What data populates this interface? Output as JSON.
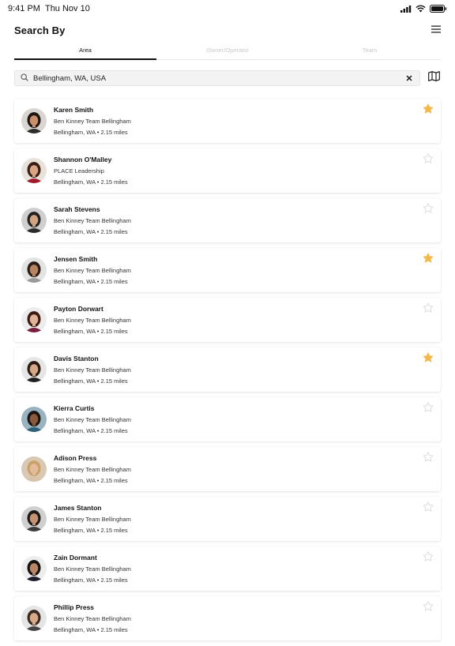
{
  "status": {
    "time": "9:41 PM",
    "date": "Thu Nov 10"
  },
  "header": {
    "title": "Search By"
  },
  "tabs": [
    {
      "label": "Area"
    },
    {
      "label": "Owner/Operator"
    },
    {
      "label": "Team"
    }
  ],
  "search": {
    "value": "Bellingham, WA, USA",
    "placeholder": ""
  },
  "colors": {
    "star_filled": "#f2b84b",
    "star_empty": "#d9d9d9",
    "accent": "#111111"
  },
  "agents": [
    {
      "name": "Karen Smith",
      "team": "Ben Kinney Team Bellingham",
      "location": "Bellingham, WA • 2.15 miles",
      "favorite": true,
      "avatar_bg": "#d9d5d0",
      "hair": "#1e1612",
      "skin": "#c98f6a",
      "shirt": "#2b2b2b"
    },
    {
      "name": "Shannon O'Malley",
      "team": "PLACE Leadership",
      "location": "Bellingham, WA • 2.15 miles",
      "favorite": false,
      "avatar_bg": "#e8e2db",
      "hair": "#3a1f14",
      "skin": "#d9a585",
      "shirt": "#a11a2a"
    },
    {
      "name": "Sarah Stevens",
      "team": "Ben Kinney Team Bellingham",
      "location": "Bellingham, WA • 2.15 miles",
      "favorite": false,
      "avatar_bg": "#cfcfcf",
      "hair": "#222222",
      "skin": "#d2a383",
      "shirt": "#2a2a2a"
    },
    {
      "name": "Jensen Smith",
      "team": "Ben Kinney Team Bellingham",
      "location": "Bellingham, WA • 2.15 miles",
      "favorite": true,
      "avatar_bg": "#e3e3e3",
      "hair": "#2b1d16",
      "skin": "#b98461",
      "shirt": "#9a9a9a"
    },
    {
      "name": "Payton Dorwart",
      "team": "Ben Kinney Team Bellingham",
      "location": "Bellingham, WA • 2.15 miles",
      "favorite": false,
      "avatar_bg": "#ececec",
      "hair": "#3d1b12",
      "skin": "#e1b398",
      "shirt": "#7a1c3c"
    },
    {
      "name": "Davis Stanton",
      "team": "Ben Kinney Team Bellingham",
      "location": "Bellingham, WA • 2.15 miles",
      "favorite": true,
      "avatar_bg": "#e6e6e6",
      "hair": "#2a1c14",
      "skin": "#d6a888",
      "shirt": "#1f1f1f"
    },
    {
      "name": "Kierra Curtis",
      "team": "Ben Kinney Team Bellingham",
      "location": "Bellingham, WA • 2.15 miles",
      "favorite": false,
      "avatar_bg": "#9ab3c0",
      "hair": "#1c1410",
      "skin": "#8a5a3c",
      "shirt": "#2e5f7a"
    },
    {
      "name": "Adison Press",
      "team": "Ben Kinney Team Bellingham",
      "location": "Bellingham, WA • 2.15 miles",
      "favorite": false,
      "avatar_bg": "#d8c8b4",
      "hair": "#c9a26a",
      "skin": "#e4bc9c",
      "shirt": "#d9c2a8"
    },
    {
      "name": "James Stanton",
      "team": "Ben Kinney Team Bellingham",
      "location": "Bellingham, WA • 2.15 miles",
      "favorite": false,
      "avatar_bg": "#d0d0d0",
      "hair": "#1e1a18",
      "skin": "#c49373",
      "shirt": "#3a3a3a"
    },
    {
      "name": "Zain Dormant",
      "team": "Ben Kinney Team Bellingham",
      "location": "Bellingham, WA • 2.15 miles",
      "favorite": false,
      "avatar_bg": "#ededed",
      "hair": "#15110f",
      "skin": "#b88566",
      "shirt": "#1c1c2a"
    },
    {
      "name": "Phillip Press",
      "team": "Ben Kinney Team Bellingham",
      "location": "Bellingham, WA • 2.15 miles",
      "favorite": false,
      "avatar_bg": "#e5e5e5",
      "hair": "#3a2a20",
      "skin": "#d8aa8a",
      "shirt": "#444444"
    }
  ]
}
